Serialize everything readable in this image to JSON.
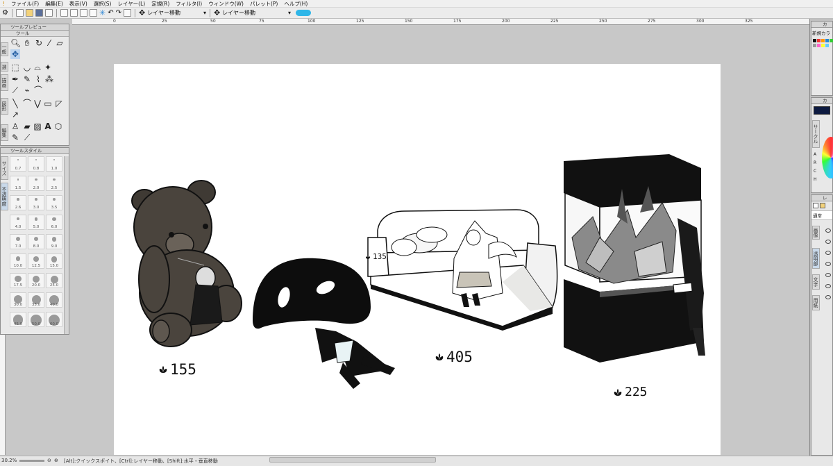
{
  "menu": [
    "ファイル(F)",
    "編集(E)",
    "表示(V)",
    "選択(S)",
    "レイヤー(L)",
    "定規(R)",
    "フィルタ(I)",
    "ウィンドウ(W)",
    "パレット(P)",
    "ヘルプ(H)"
  ],
  "toolbar": {
    "move_layer_label_1": "レイヤー移動",
    "move_layer_label_2": "レイヤー移動"
  },
  "ruler": {
    "ticks": [
      "0",
      "25",
      "50",
      "75",
      "100",
      "125",
      "150",
      "175",
      "200",
      "225",
      "250",
      "275",
      "300",
      "325"
    ]
  },
  "tool_preview_panel": {
    "title": "ツールプレビュー",
    "subtitle": "ツール",
    "tabs": [
      "一般",
      "選",
      "描画",
      "図形",
      "編集"
    ]
  },
  "tool_style_panel": {
    "title": "ツールスタイル",
    "tabs": [
      "サイズ",
      "不透明度"
    ],
    "brush_sizes": [
      "0.7",
      "0.8",
      "1.0",
      "1.5",
      "2.0",
      "2.5",
      "2.6",
      "3.0",
      "3.5",
      "4.0",
      "5.0",
      "6.0",
      "7.0",
      "8.0",
      "9.0",
      "10.0",
      "12.5",
      "15.0",
      "17.5",
      "20.0",
      "25.0",
      "30.0",
      "35.0",
      "40.0",
      "45.0",
      "50.0",
      "60.0"
    ]
  },
  "right_panels": {
    "color_set_title": "カ",
    "color_set_label": "新規カラ",
    "color_circle_title": "カ",
    "color_circle_tab": "サークル",
    "color_circle_letters": [
      "A",
      "R",
      "C",
      "H"
    ],
    "layer_title": "レ",
    "blend_mode": "通常",
    "layer_tabs": [
      "画像",
      "透明部",
      "文字",
      "用紙"
    ]
  },
  "artwork": {
    "prices": [
      "155",
      "135",
      "405",
      "225"
    ]
  },
  "status": {
    "zoom": "30.2%",
    "hint": "[Alt]:クイックスポイト、[Ctrl]:レイヤー移動、[Shift]:水平・垂直移動"
  },
  "colors": {
    "canvas_bg": "#c8c8c8",
    "panel_bg": "#e9e9e9",
    "accent_blue": "#2a86d6",
    "paper": "#ffffff"
  }
}
